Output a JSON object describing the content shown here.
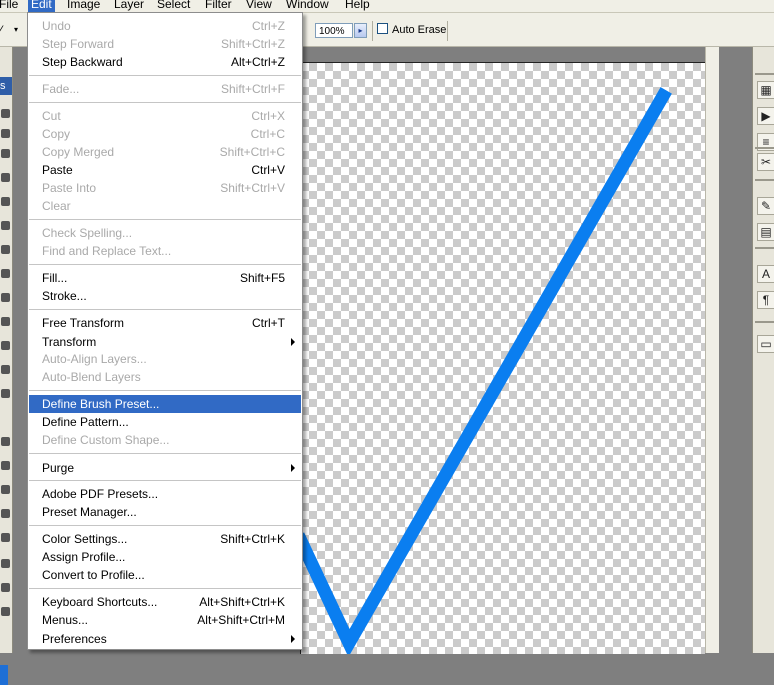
{
  "menubar": {
    "items": [
      "File",
      "Edit",
      "Image",
      "Layer",
      "Select",
      "Filter",
      "View",
      "Window",
      "Help"
    ],
    "file": "File",
    "edit": "Edit",
    "image": "Image",
    "layer": "Layer",
    "select": "Select",
    "filter": "Filter",
    "view": "View",
    "window": "Window",
    "help": "Help"
  },
  "options": {
    "flow_value": "100%",
    "auto_erase_label": "Auto Erase",
    "auto_erase_checked": false
  },
  "edit_menu": {
    "undo": {
      "label": "Undo",
      "shortcut": "Ctrl+Z",
      "enabled": false
    },
    "step_forward": {
      "label": "Step Forward",
      "shortcut": "Shift+Ctrl+Z",
      "enabled": false
    },
    "step_backward": {
      "label": "Step Backward",
      "shortcut": "Alt+Ctrl+Z",
      "enabled": true
    },
    "fade": {
      "label": "Fade...",
      "shortcut": "Shift+Ctrl+F",
      "enabled": false
    },
    "cut": {
      "label": "Cut",
      "shortcut": "Ctrl+X",
      "enabled": false
    },
    "copy": {
      "label": "Copy",
      "shortcut": "Ctrl+C",
      "enabled": false
    },
    "copy_merged": {
      "label": "Copy Merged",
      "shortcut": "Shift+Ctrl+C",
      "enabled": false
    },
    "paste": {
      "label": "Paste",
      "shortcut": "Ctrl+V",
      "enabled": true
    },
    "paste_into": {
      "label": "Paste Into",
      "shortcut": "Shift+Ctrl+V",
      "enabled": false
    },
    "clear": {
      "label": "Clear",
      "enabled": false
    },
    "check_spelling": {
      "label": "Check Spelling...",
      "enabled": false
    },
    "find_replace": {
      "label": "Find and Replace Text...",
      "enabled": false
    },
    "fill": {
      "label": "Fill...",
      "shortcut": "Shift+F5",
      "enabled": true
    },
    "stroke": {
      "label": "Stroke...",
      "enabled": true
    },
    "free_transform": {
      "label": "Free Transform",
      "shortcut": "Ctrl+T",
      "enabled": true
    },
    "transform": {
      "label": "Transform",
      "enabled": true,
      "submenu": true
    },
    "auto_align": {
      "label": "Auto-Align Layers...",
      "enabled": false
    },
    "auto_blend": {
      "label": "Auto-Blend Layers",
      "enabled": false
    },
    "define_brush": {
      "label": "Define Brush Preset...",
      "enabled": true,
      "highlighted": true
    },
    "define_pattern": {
      "label": "Define Pattern...",
      "enabled": true
    },
    "define_shape": {
      "label": "Define Custom Shape...",
      "enabled": false
    },
    "purge": {
      "label": "Purge",
      "enabled": true,
      "submenu": true
    },
    "pdf_presets": {
      "label": "Adobe PDF Presets...",
      "enabled": true
    },
    "preset_manager": {
      "label": "Preset Manager...",
      "enabled": true
    },
    "color_settings": {
      "label": "Color Settings...",
      "shortcut": "Shift+Ctrl+K",
      "enabled": true
    },
    "assign_profile": {
      "label": "Assign Profile...",
      "enabled": true
    },
    "convert_profile": {
      "label": "Convert to Profile...",
      "enabled": true
    },
    "keyboard_shortcuts": {
      "label": "Keyboard Shortcuts...",
      "shortcut": "Alt+Shift+Ctrl+K",
      "enabled": true
    },
    "menus": {
      "label": "Menus...",
      "shortcut": "Alt+Shift+Ctrl+M",
      "enabled": true
    },
    "preferences": {
      "label": "Preferences",
      "enabled": true,
      "submenu": true
    }
  },
  "toolbox": {
    "header": "s"
  },
  "right_panel": {
    "glyph_text": "A",
    "glyph_para": "¶"
  },
  "canvas": {
    "stroke_color": "#0a7ef0"
  }
}
